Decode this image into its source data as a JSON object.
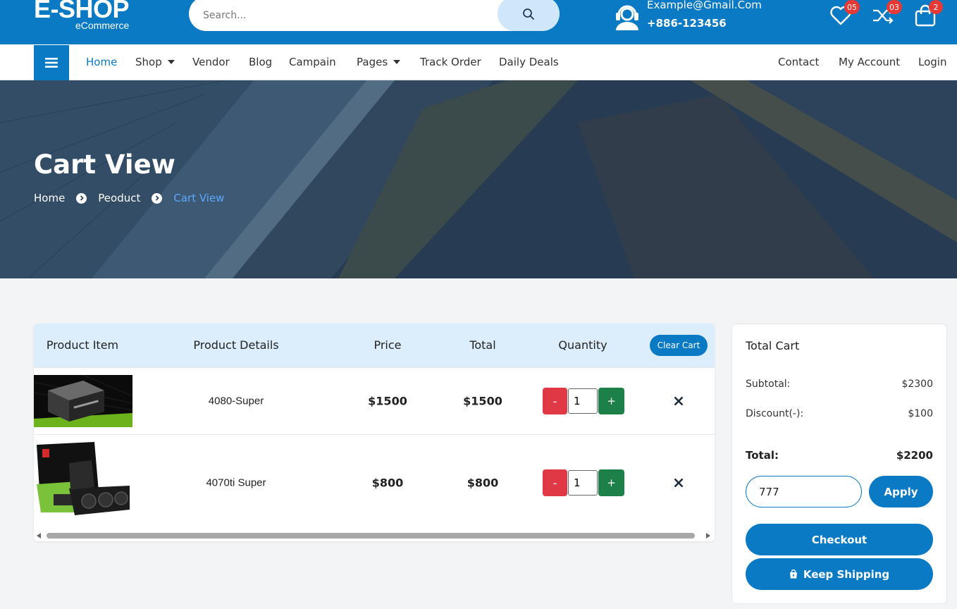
{
  "header": {
    "logo_main": "E-SHOP",
    "logo_sub": "eCommerce",
    "search_placeholder": "Search...",
    "email": "Example@Gmail.Com",
    "phone": "+886-123456",
    "wishlist_count": "05",
    "compare_count": "03",
    "cart_count": "2"
  },
  "nav": {
    "left": [
      "Home",
      "Shop",
      "Vendor",
      "Blog",
      "Campain",
      "Pages",
      "Track Order",
      "Daily Deals"
    ],
    "right": [
      "Contact",
      "My Account",
      "Login"
    ]
  },
  "hero": {
    "title": "Cart View",
    "crumbs": [
      "Home",
      "Peoduct",
      "Cart View"
    ]
  },
  "cart": {
    "headers": [
      "Product Item",
      "Product Details",
      "Price",
      "Total",
      "Quantity"
    ],
    "clear_label": "Clear Cart",
    "rows": [
      {
        "name": "4080-Super",
        "price": "$1500",
        "total": "$1500",
        "qty": "1"
      },
      {
        "name": "4070ti Super",
        "price": "$800",
        "total": "$800",
        "qty": "1"
      }
    ],
    "minus_label": "-",
    "plus_label": "+"
  },
  "summary": {
    "title": "Total Cart",
    "subtotal_label": "Subtotal:",
    "subtotal": "$2300",
    "discount_label": "Discount(-):",
    "discount": "$100",
    "total_label": "Total:",
    "total": "$2200",
    "coupon_value": "777",
    "apply_label": "Apply",
    "checkout_label": "Checkout",
    "keep_label": "Keep Shipping"
  },
  "colors": {
    "primary": "#0a7ac4",
    "minus": "#e03845",
    "plus": "#1e8049",
    "badge": "#e53935",
    "breadcrumb_current": "#5aa8ff"
  }
}
